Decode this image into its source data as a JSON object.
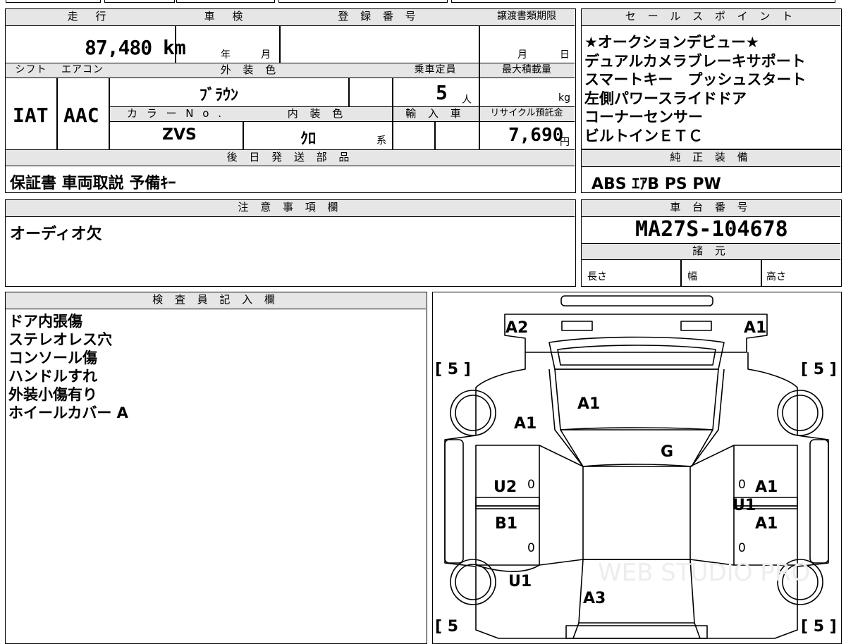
{
  "vehicle": {
    "headers": {
      "mileage": "走 行",
      "inspection": "車 検",
      "registration": "登 録 番 号",
      "transfer_deadline": "譲渡書類期限",
      "shift": "シフト",
      "aircon": "エアコン",
      "exterior_color": "外 装 色",
      "capacity": "乗車定員",
      "max_load": "最大積載量",
      "color_no": "カ ラ ー N o .",
      "interior_color": "内 装 色",
      "import": "輸 入 車",
      "recycle_fee": "リサイクル預託金"
    },
    "mileage": "87,480 km",
    "inspection_year_unit": "年",
    "inspection_month_unit": "月",
    "transfer_month_unit": "月",
    "transfer_day_unit": "日",
    "shift": "IAT",
    "aircon": "AAC",
    "exterior_color": "ﾌﾞﾗｳﾝ",
    "capacity": "5",
    "capacity_unit": "人",
    "max_load_unit": "kg",
    "color_no": "ZVS",
    "interior_color": "ｸﾛ",
    "interior_suffix": "系",
    "recycle_fee": "7,690",
    "recycle_unit": "円"
  },
  "later_parts": {
    "header": "後 日 発 送 部 品",
    "value": "保証書 車両取説 予備ｷｰ"
  },
  "sales_points": {
    "header": "セ ー ル ス ポ イ ン ト",
    "items": [
      "★オークションデビュー★",
      "デュアルカメラブレーキサポート",
      "スマートキー　プッシュスタート",
      "左側パワースライドドア",
      "コーナーセンサー",
      "ビルトインＥＴＣ"
    ]
  },
  "standard_equipment": {
    "header": "純 正 装 備",
    "value": "ABS ｴｱB PS PW"
  },
  "caution": {
    "header": "注 意 事 項 欄",
    "value": "オーディオ欠"
  },
  "chassis": {
    "header": "車 台 番 号",
    "value": "MA27S-104678",
    "spec_header": "諸 元",
    "length_label": "長さ",
    "width_label": "幅",
    "height_label": "高さ"
  },
  "inspector": {
    "header": "検 査 員 記 入 欄",
    "notes": [
      "ドア内張傷",
      "ステレオレス穴",
      "コンソール傷",
      "ハンドルすれ",
      "外装小傷有り",
      "ホイールカバー A"
    ]
  },
  "diagram": {
    "tire_tl": "[ 5 ]",
    "tire_tr": "[ 5 ]",
    "tire_bl": "[ 5",
    "tire_br": "[ 5 ]",
    "marks": {
      "a2_rear_left": "A2",
      "a1_rear_right": "A1",
      "a1_roof": "A1",
      "a1_left_pillar": "A1",
      "g_windshield": "G",
      "u2_left_door": "U2",
      "b1_left_door": "B1",
      "u1_left_front": "U1",
      "a3_hood": "A3",
      "a1_right_door_upper": "A1",
      "u1_right_door": "U1",
      "a1_right_door_lower": "A1"
    },
    "zero_marks": [
      "0",
      "0",
      "0",
      "0"
    ],
    "watermark": "WEB STUDIO PRO"
  }
}
